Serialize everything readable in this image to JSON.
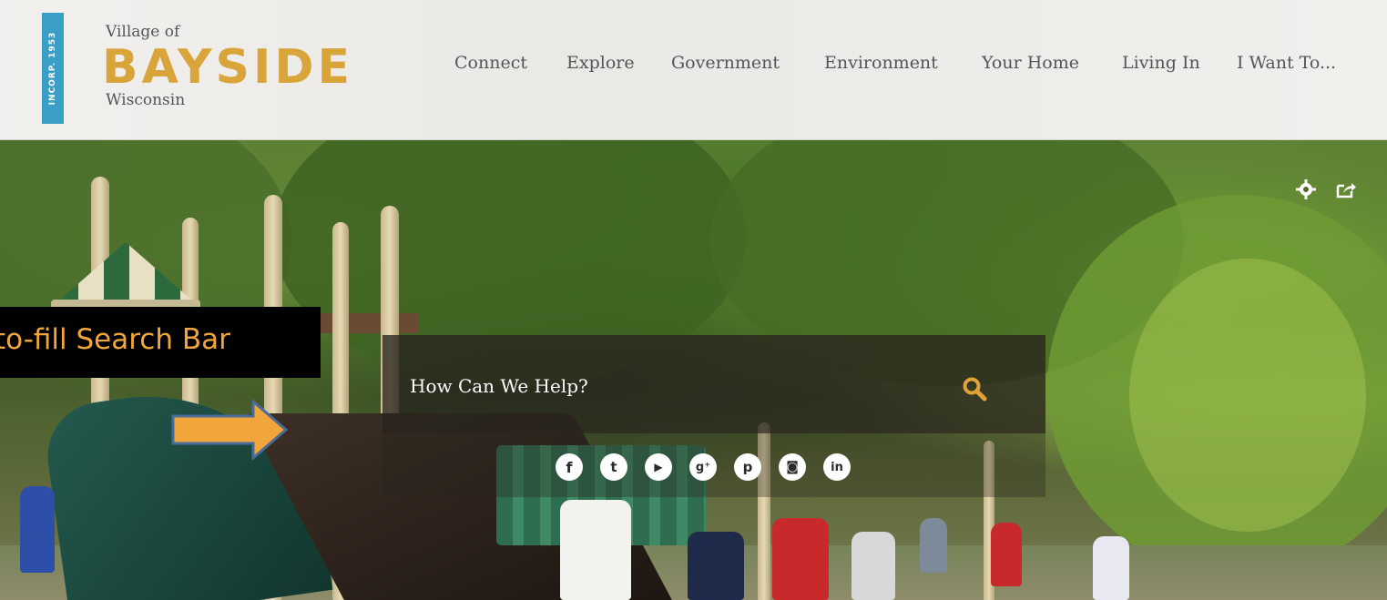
{
  "brand": {
    "incorp": "INCORP. 1953",
    "top_line": "Village of",
    "name": "BAYSIDE",
    "bottom_line": "Wisconsin",
    "colors": {
      "badge": "#3a9fc7",
      "name": "#d9a43a"
    }
  },
  "nav": {
    "items": [
      "Connect",
      "Explore",
      "Government",
      "Environment",
      "Your Home",
      "Living In",
      "I Want To..."
    ]
  },
  "hero": {
    "tools": [
      "gear-icon",
      "share-icon"
    ]
  },
  "search": {
    "placeholder": "How Can We Help?",
    "button_icon": "search-icon",
    "accent": "#e2a23a"
  },
  "social": {
    "items": [
      {
        "name": "facebook-icon",
        "glyph": "f"
      },
      {
        "name": "twitter-icon",
        "glyph": "t"
      },
      {
        "name": "youtube-icon",
        "glyph": "▶"
      },
      {
        "name": "googleplus-icon",
        "glyph": "g⁺"
      },
      {
        "name": "pinterest-icon",
        "glyph": "p"
      },
      {
        "name": "instagram-icon",
        "glyph": "◙"
      },
      {
        "name": "linkedin-icon",
        "glyph": "in"
      }
    ]
  },
  "annotation": {
    "label": "to-fill Search Bar",
    "color": "#f0a63a"
  }
}
